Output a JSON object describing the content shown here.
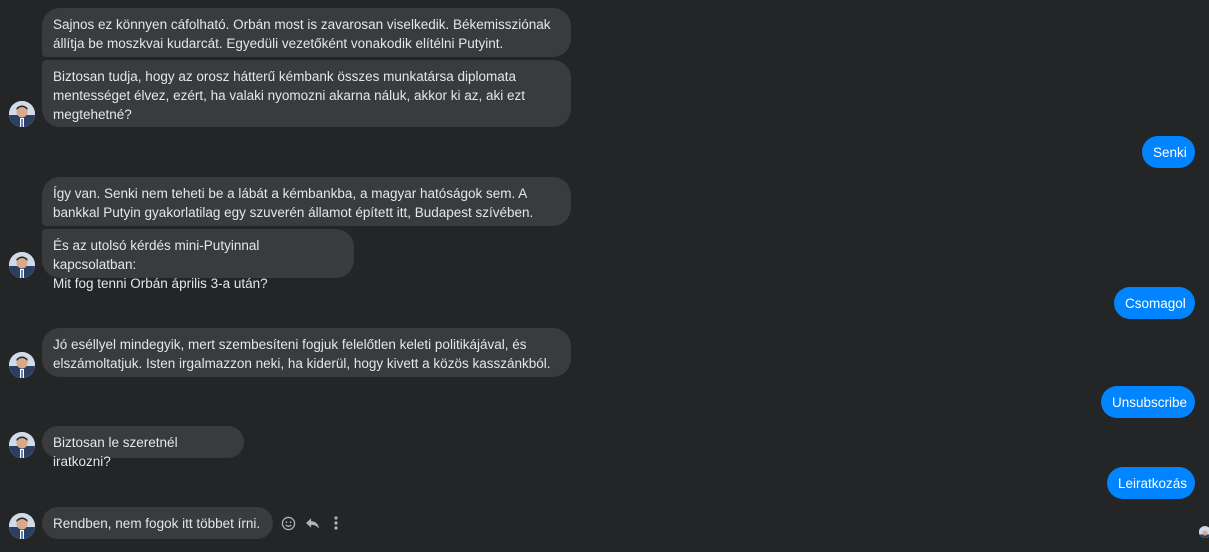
{
  "incoming": {
    "m1": "Sajnos ez könnyen cáfolható. Orbán most is zavarosan viselkedik. Békemissziónak\nállítja be moszkvai kudarcát. Egyedüli vezetőként vonakodik elítélni Putyint.",
    "m2": "Biztosan tudja, hogy az orosz hátterű kémbank összes munkatársa diplomata\nmentességet élvez, ezért, ha valaki nyomozni akarna náluk, akkor ki az, aki ezt\nmegtehetné?",
    "m3": "Így van. Senki nem teheti be a lábát a kémbankba, a magyar hatóságok sem. A\nbankkal Putyin gyakorlatilag egy szuverén államot épített itt, Budapest szívében.",
    "m4": "És az utolsó kérdés mini-Putyinnal kapcsolatban:\nMit fog tenni Orbán április 3-a után?",
    "m5": "Jó eséllyel mindegyik, mert szembesíteni fogjuk felelőtlen keleti politikájával, és\nelszámoltatjuk. Isten irgalmazzon neki, ha kiderül, hogy kivett a közös kasszánkból.",
    "m6": "Biztosan le szeretnél iratkozni?",
    "m7": "Rendben, nem fogok itt többet írni."
  },
  "outgoing": {
    "o1": "Senki",
    "o2": "Csomagol",
    "o3": "Unsubscribe",
    "o4": "Leiratkozás"
  },
  "message_actions": {
    "react": "smile-icon",
    "reply": "reply-icon",
    "more": "more-vertical-icon"
  },
  "colors": {
    "background": "#242526",
    "incoming_bubble": "#3a3b3c",
    "outgoing_bubble": "#0084ff",
    "text": "#e4e6eb"
  }
}
